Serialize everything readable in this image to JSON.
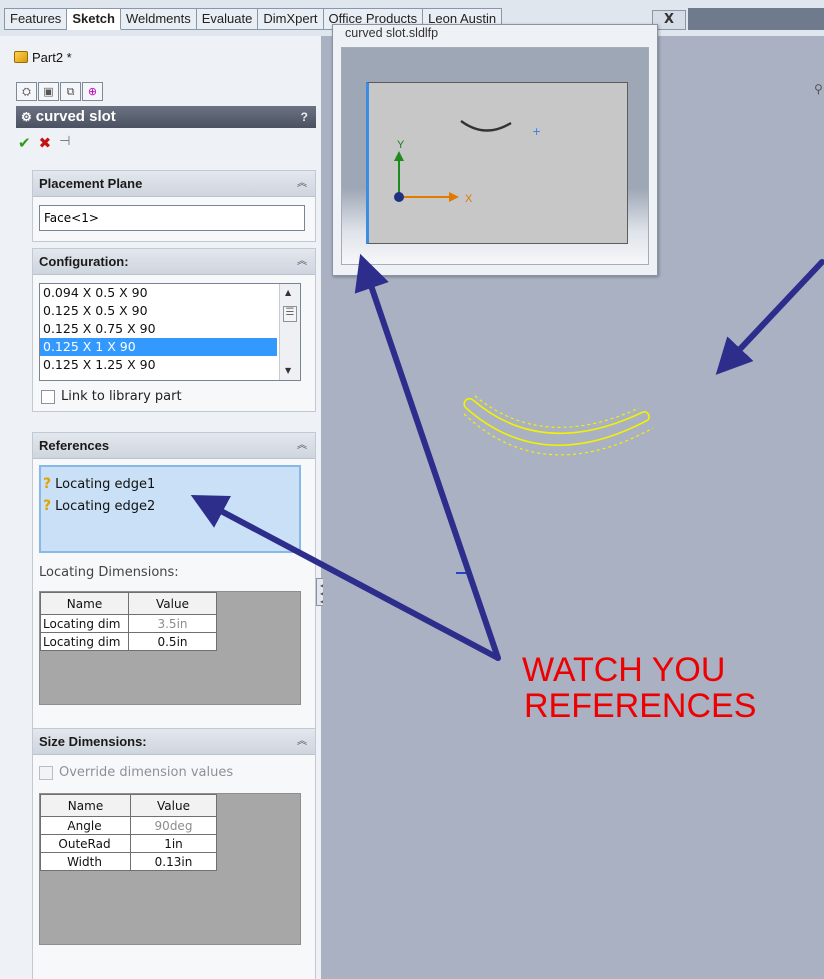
{
  "command_tabs": [
    {
      "label": "Features",
      "active": false
    },
    {
      "label": "Sketch",
      "active": true
    },
    {
      "label": "Weldments",
      "active": false
    },
    {
      "label": "Evaluate",
      "active": false
    },
    {
      "label": "DimXpert",
      "active": false
    },
    {
      "label": "Office Products",
      "active": false
    },
    {
      "label": "Leon Austin",
      "active": false
    }
  ],
  "tab_close_label": "X",
  "document": {
    "name": "Part2 *"
  },
  "manager_tabs": [
    {
      "icon": "feature-manager-icon",
      "glyph": "⛭"
    },
    {
      "icon": "property-manager-icon",
      "glyph": "▣"
    },
    {
      "icon": "configuration-manager-icon",
      "glyph": "⧉"
    },
    {
      "icon": "dimxpert-manager-icon",
      "glyph": "⊕"
    }
  ],
  "property_manager": {
    "title": "curved slot",
    "help_glyph": "?",
    "actions": {
      "ok": "✔",
      "cancel": "✖",
      "pin": "⊣"
    },
    "placement_plane": {
      "heading": "Placement Plane",
      "value": "Face<1>"
    },
    "configuration": {
      "heading": "Configuration:",
      "items": [
        "0.094 X 0.5 X 90",
        "0.125 X 0.5 X 90",
        "0.125 X 0.75 X 90",
        "0.125 X 1 X 90",
        "0.125 X 1.25 X 90"
      ],
      "selected_index": 3,
      "link_label": "Link to library part",
      "link_checked": false
    },
    "references": {
      "heading": "References",
      "items": [
        "Locating edge1",
        "Locating edge2"
      ],
      "locating_label": "Locating Dimensions:",
      "columns": [
        "Name",
        "Value"
      ],
      "rows": [
        {
          "name": "Locating dim",
          "value": "3.5in",
          "greyed": true
        },
        {
          "name": "Locating dim",
          "value": "0.5in",
          "greyed": false
        }
      ]
    },
    "size_dimensions": {
      "heading": "Size Dimensions:",
      "override_label": "Override dimension values",
      "override_checked": false,
      "columns": [
        "Name",
        "Value"
      ],
      "rows": [
        {
          "name": "Angle",
          "value": "90deg",
          "greyed": true
        },
        {
          "name": "OuteRad",
          "value": "1in",
          "greyed": false
        },
        {
          "name": "Width",
          "value": "0.13in",
          "greyed": false
        }
      ]
    }
  },
  "preview": {
    "title": "curved slot.sldlfp",
    "axis_x": "X",
    "axis_y": "Y"
  },
  "annotation": {
    "line1": "WATCH YOU",
    "line2": "REFERENCES",
    "color": "#ee0000",
    "arrow_color": "#2d2d8c"
  },
  "colors": {
    "graphics_bg": "#a9b1c3",
    "slot_outline": "#f2f200",
    "selection": "#3399ff"
  }
}
